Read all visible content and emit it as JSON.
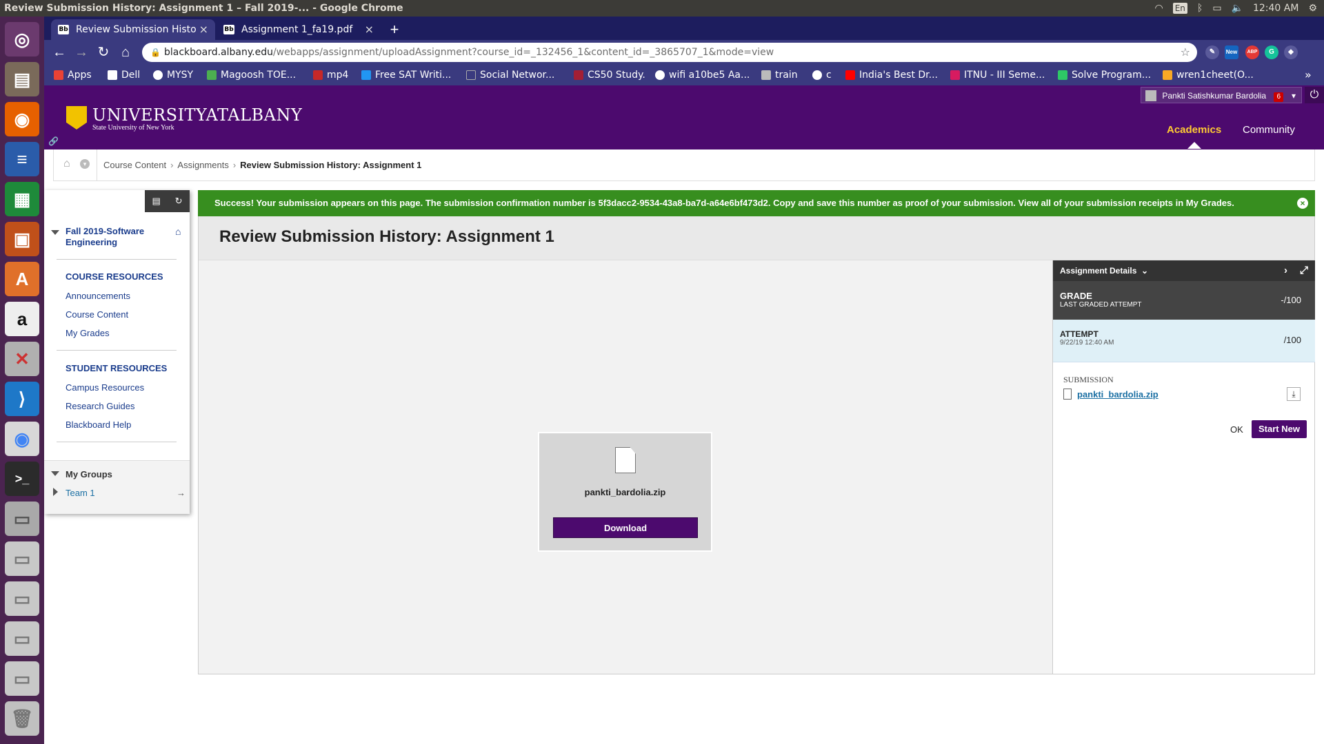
{
  "os": {
    "window_title": "Review Submission History: Assignment 1 – Fall 2019-... - Google Chrome",
    "lang": "En",
    "clock": "12:40 AM"
  },
  "browser": {
    "tabs": [
      {
        "label": "Review Submission Histo",
        "favicon": "Bb"
      },
      {
        "label": "Assignment 1_fa19.pdf",
        "favicon": "Bb"
      }
    ],
    "url_host": "blackboard.albany.edu",
    "url_path": "/webapps/assignment/uploadAssignment?course_id=_132456_1&content_id=_3865707_1&mode=view",
    "ext_new": "New",
    "ext_abp": "ABP",
    "bookmarks": [
      {
        "label": "Apps",
        "color": "#e94235"
      },
      {
        "label": "Dell",
        "color": "#ffffff"
      },
      {
        "label": "MYSY",
        "color": "#ffffff"
      },
      {
        "label": "Magoosh TOE...",
        "color": "#4caf50"
      },
      {
        "label": "mp4",
        "color": "#c62828"
      },
      {
        "label": "Free SAT Writi...",
        "color": "#2196f3"
      },
      {
        "label": "Social Networ...",
        "color": "#3a3a7f"
      },
      {
        "label": "CS50 Study.",
        "color": "#a31f34"
      },
      {
        "label": "wifi a10be5 Aa...",
        "color": "#ffffff"
      },
      {
        "label": "train",
        "color": "#bbbbbb"
      },
      {
        "label": "c",
        "color": "#ffffff"
      },
      {
        "label": "India's Best Dr...",
        "color": "#ff0000"
      },
      {
        "label": "ITNU - III Seme...",
        "color": "#d81b60"
      },
      {
        "label": "Solve Program...",
        "color": "#2ec866"
      },
      {
        "label": "wren1cheet(O...",
        "color": "#f9a825"
      }
    ],
    "more": "»"
  },
  "header": {
    "logo_main": "UNIVERSITYATALBANY",
    "logo_sub": "State University of New York",
    "user_name": "Pankti Satishkumar Bardolia",
    "notification_count": "6",
    "nav_tabs": [
      "Academics",
      "Community"
    ]
  },
  "breadcrumb": {
    "items": [
      "Course Content",
      "Assignments"
    ],
    "current": "Review Submission History: Assignment 1"
  },
  "course_menu": {
    "course_name": "Fall 2019-Software Engineering",
    "sections": [
      {
        "heading": "COURSE RESOURCES",
        "links": [
          "Announcements",
          "Course Content",
          "My Grades"
        ]
      },
      {
        "heading": "STUDENT RESOURCES",
        "links": [
          "Campus Resources",
          "Research Guides",
          "Blackboard Help"
        ]
      }
    ],
    "groups_heading": "My Groups",
    "group_item": "Team 1",
    "group_arrow": "→"
  },
  "alert": {
    "text": "Success! Your submission appears on this page. The submission confirmation number is 5f3dacc2-9534-43a8-ba7d-a64e6bf473d2. Copy and save this number as proof of your submission.",
    "link": "View all of your submission receipts in My Grades.",
    "color": "#378e1f"
  },
  "page_title": "Review Submission History: Assignment 1",
  "file_viewer": {
    "file_name": "pankti_bardolia.zip",
    "download_label": "Download"
  },
  "details_panel": {
    "header": "Assignment Details",
    "grade_label": "GRADE",
    "grade_sub": "LAST GRADED ATTEMPT",
    "grade_value": "-/100",
    "attempt_label": "ATTEMPT",
    "attempt_date": "9/22/19 12:40 AM",
    "attempt_value": "/100",
    "submission_label": "SUBMISSION",
    "submission_file": "pankti_bardolia.zip",
    "ok_label": "OK",
    "start_new_label": "Start New"
  },
  "colors": {
    "brand_purple": "#4c0a6e",
    "accent_gold": "#ffcc33",
    "launcher": "#4b2450"
  }
}
